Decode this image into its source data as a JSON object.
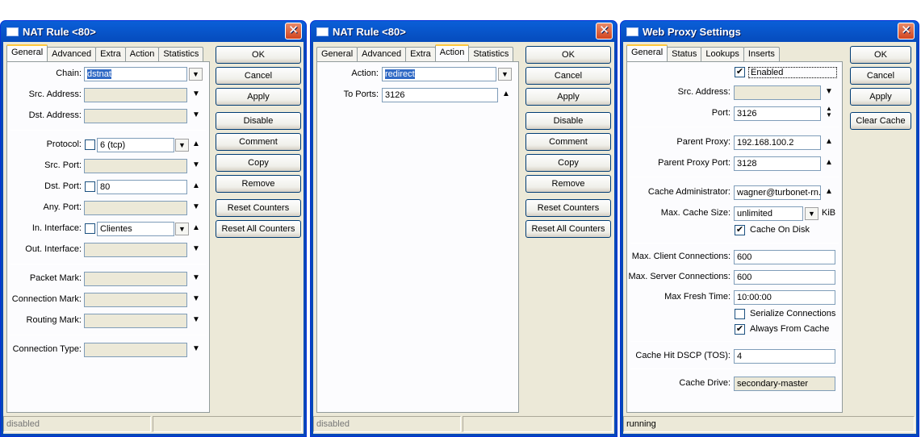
{
  "win1": {
    "title": "NAT Rule <80>",
    "tabs": [
      "General",
      "Advanced",
      "Extra",
      "Action",
      "Statistics"
    ],
    "fields": {
      "chain_label": "Chain:",
      "chain_value": "dstnat",
      "src_address_label": "Src. Address:",
      "dst_address_label": "Dst. Address:",
      "protocol_label": "Protocol:",
      "protocol_value": "6 (tcp)",
      "src_port_label": "Src. Port:",
      "dst_port_label": "Dst. Port:",
      "dst_port_value": "80",
      "any_port_label": "Any. Port:",
      "in_interface_label": "In. Interface:",
      "in_interface_value": "Clientes",
      "out_interface_label": "Out. Interface:",
      "packet_mark_label": "Packet Mark:",
      "connection_mark_label": "Connection Mark:",
      "routing_mark_label": "Routing Mark:",
      "connection_type_label": "Connection Type:"
    },
    "buttons": [
      "OK",
      "Cancel",
      "Apply",
      "Disable",
      "Comment",
      "Copy",
      "Remove",
      "Reset Counters",
      "Reset All Counters"
    ],
    "status": "disabled"
  },
  "win2": {
    "title": "NAT Rule <80>",
    "tabs": [
      "General",
      "Advanced",
      "Extra",
      "Action",
      "Statistics"
    ],
    "fields": {
      "action_label": "Action:",
      "action_value": "redirect",
      "to_ports_label": "To Ports:",
      "to_ports_value": "3126"
    },
    "buttons": [
      "OK",
      "Cancel",
      "Apply",
      "Disable",
      "Comment",
      "Copy",
      "Remove",
      "Reset Counters",
      "Reset All Counters"
    ],
    "status": "disabled"
  },
  "win3": {
    "title": "Web Proxy Settings",
    "tabs": [
      "General",
      "Status",
      "Lookups",
      "Inserts"
    ],
    "fields": {
      "enabled_label": "Enabled",
      "src_address_label": "Src. Address:",
      "port_label": "Port:",
      "port_value": "3126",
      "parent_proxy_label": "Parent Proxy:",
      "parent_proxy_value": "192.168.100.2",
      "parent_proxy_port_label": "Parent Proxy Port:",
      "parent_proxy_port_value": "3128",
      "cache_admin_label": "Cache Administrator:",
      "cache_admin_value": "wagner@turbonet-rn.",
      "max_cache_size_label": "Max. Cache Size:",
      "max_cache_size_value": "unlimited",
      "max_cache_size_unit": "KiB",
      "cache_on_disk_label": "Cache On Disk",
      "max_client_conn_label": "Max. Client Connections:",
      "max_client_conn_value": "600",
      "max_server_conn_label": "Max. Server Connections:",
      "max_server_conn_value": "600",
      "max_fresh_time_label": "Max Fresh Time:",
      "max_fresh_time_value": "10:00:00",
      "serialize_conn_label": "Serialize Connections",
      "always_from_cache_label": "Always From Cache",
      "cache_hit_dscp_label": "Cache Hit DSCP (TOS):",
      "cache_hit_dscp_value": "4",
      "cache_drive_label": "Cache Drive:",
      "cache_drive_value": "secondary-master"
    },
    "buttons": [
      "OK",
      "Cancel",
      "Apply",
      "Clear Cache"
    ],
    "status": "running"
  }
}
